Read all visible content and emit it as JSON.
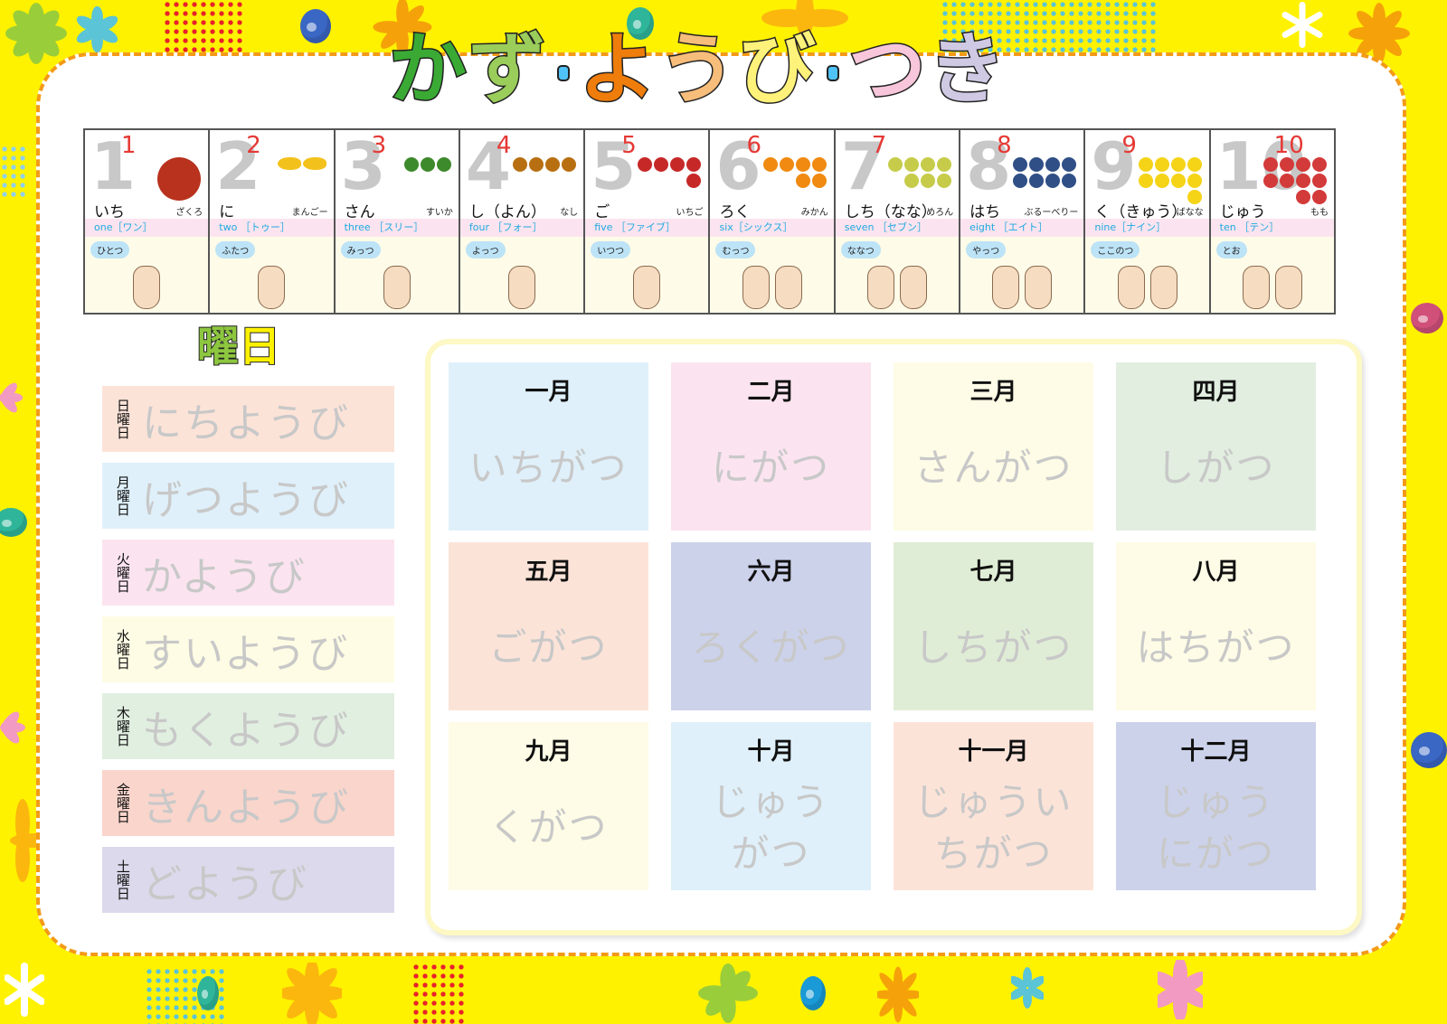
{
  "title": {
    "parts": [
      "かず",
      "ようび",
      "つき"
    ],
    "chars": [
      {
        "ch": "か",
        "color": "#3aaa35"
      },
      {
        "ch": "ず",
        "color": "#9acd5a"
      },
      {
        "ch": "よ",
        "color": "#ef7d0b"
      },
      {
        "ch": "う",
        "color": "#f7bd7a"
      },
      {
        "ch": "び",
        "color": "#fff27a"
      },
      {
        "ch": "つ",
        "color": "#f7c6da"
      },
      {
        "ch": "き",
        "color": "#cfc9e4"
      }
    ]
  },
  "numbers": [
    {
      "digit": "1",
      "reading": "いち",
      "fruit_name": "ざくろ",
      "english": "one［ワン］",
      "count_word": "ひとつ",
      "fruit": "pomegranate"
    },
    {
      "digit": "2",
      "reading": "に",
      "fruit_name": "まんごー",
      "english": "two ［トゥー］",
      "count_word": "ふたつ",
      "fruit": "mango"
    },
    {
      "digit": "3",
      "reading": "さん",
      "fruit_name": "すいか",
      "english": "three ［スリー］",
      "count_word": "みっつ",
      "fruit": "watermelon"
    },
    {
      "digit": "4",
      "reading": "し（よん）",
      "fruit_name": "なし",
      "english": "four ［フォー］",
      "count_word": "よっつ",
      "fruit": "pear"
    },
    {
      "digit": "5",
      "reading": "ご",
      "fruit_name": "いちご",
      "english": "five ［ファイブ］",
      "count_word": "いつつ",
      "fruit": "strawberry"
    },
    {
      "digit": "6",
      "reading": "ろく",
      "fruit_name": "みかん",
      "english": "six［シックス］",
      "count_word": "むっつ",
      "fruit": "mandarin"
    },
    {
      "digit": "7",
      "reading": "しち（なな）",
      "fruit_name": "めろん",
      "english": "seven ［セブン］",
      "count_word": "ななつ",
      "fruit": "melon"
    },
    {
      "digit": "8",
      "reading": "はち",
      "fruit_name": "ぶるーべりー",
      "english": "eight ［エイト］",
      "count_word": "やっつ",
      "fruit": "blueberry"
    },
    {
      "digit": "9",
      "reading": "く（きゅう）",
      "fruit_name": "ばなな",
      "english": "nine［ナイン］",
      "count_word": "ここのつ",
      "fruit": "banana"
    },
    {
      "digit": "10",
      "reading": "じゅう",
      "fruit_name": "もも",
      "english": "ten ［テン］",
      "count_word": "とお",
      "fruit": "peach"
    }
  ],
  "days_section": {
    "title_k1": "曜",
    "title_k2": "日",
    "days": [
      {
        "kanji": "日曜日",
        "kana": "にちようび",
        "color": "#fce3d8"
      },
      {
        "kanji": "月曜日",
        "kana": "げつようび",
        "color": "#dff0fa"
      },
      {
        "kanji": "火曜日",
        "kana": "かようび",
        "color": "#fbe4ef"
      },
      {
        "kanji": "水曜日",
        "kana": "すいようび",
        "color": "#fefce4"
      },
      {
        "kanji": "木曜日",
        "kana": "もくようび",
        "color": "#e1efe0"
      },
      {
        "kanji": "金曜日",
        "kana": "きんようび",
        "color": "#fad5cc"
      },
      {
        "kanji": "土曜日",
        "kana": "どようび",
        "color": "#dcd9ec"
      }
    ]
  },
  "months": [
    {
      "kanji": "一月",
      "kana": "いちがつ",
      "color": "#dff0fa"
    },
    {
      "kanji": "二月",
      "kana": "にがつ",
      "color": "#fbe4ef"
    },
    {
      "kanji": "三月",
      "kana": "さんがつ",
      "color": "#fefce6"
    },
    {
      "kanji": "四月",
      "kana": "しがつ",
      "color": "#e1eee0"
    },
    {
      "kanji": "五月",
      "kana": "ごがつ",
      "color": "#fce3d8"
    },
    {
      "kanji": "六月",
      "kana": "ろくがつ",
      "color": "#ccd2ea"
    },
    {
      "kanji": "七月",
      "kana": "しちがつ",
      "color": "#e0edd6"
    },
    {
      "kanji": "八月",
      "kana": "はちがつ",
      "color": "#fefce6"
    },
    {
      "kanji": "九月",
      "kana": "くがつ",
      "color": "#fefce6"
    },
    {
      "kanji": "十月",
      "kana": "じゅう\nがつ",
      "color": "#dff0fa"
    },
    {
      "kanji": "十一月",
      "kana": "じゅうい\nちがつ",
      "color": "#fce3d8"
    },
    {
      "kanji": "十二月",
      "kana": "じゅう\nにがつ",
      "color": "#ccd2ea"
    }
  ]
}
